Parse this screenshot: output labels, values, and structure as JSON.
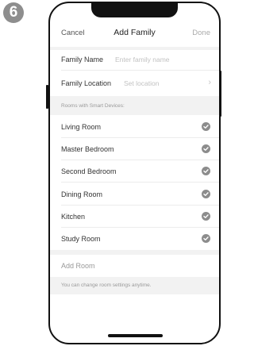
{
  "step": {
    "number": "6"
  },
  "nav": {
    "cancel_label": "Cancel",
    "title": "Add Family",
    "done_label": "Done"
  },
  "form": {
    "family_name": {
      "label": "Family Name",
      "placeholder": "Enter family name"
    },
    "family_location": {
      "label": "Family Location",
      "placeholder": "Set location",
      "chevron": "chevron-right-icon"
    }
  },
  "rooms": {
    "header": "Rooms with Smart Devices:",
    "items": [
      {
        "label": "Living Room",
        "checked": true
      },
      {
        "label": "Master Bedroom",
        "checked": true
      },
      {
        "label": "Second Bedroom",
        "checked": true
      },
      {
        "label": "Dining Room",
        "checked": true
      },
      {
        "label": "Kitchen",
        "checked": true
      },
      {
        "label": "Study Room",
        "checked": true
      }
    ],
    "add_room_label": "Add Room",
    "footer_note": "You can change room settings anytime."
  },
  "colors": {
    "check_fill": "#8c8c8c",
    "badge_fill": "#8e8e8e",
    "done_disabled": "#aaaaaa",
    "section_bg": "#f2f2f2"
  }
}
